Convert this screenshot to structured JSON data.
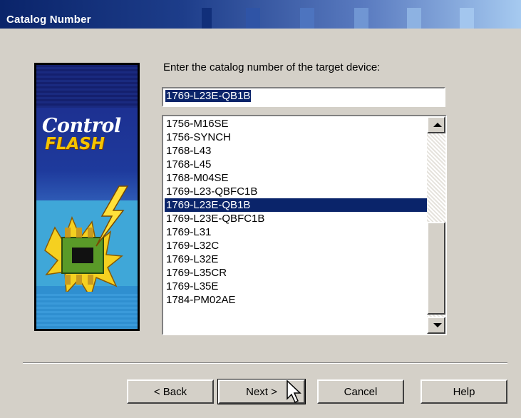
{
  "window": {
    "title": "Catalog Number"
  },
  "logo": {
    "line1": "Control",
    "line2": "FLASH"
  },
  "prompt": {
    "text": "Enter the catalog number of the target device:"
  },
  "catalog_input": {
    "value": "1769-L23E-QB1B"
  },
  "catalog_list": {
    "items": [
      "1756-M16SE",
      "1756-SYNCH",
      "1768-L43",
      "1768-L45",
      "1768-M04SE",
      "1769-L23-QBFC1B",
      "1769-L23E-QB1B",
      "1769-L23E-QBFC1B",
      "1769-L31",
      "1769-L32C",
      "1769-L32E",
      "1769-L35CR",
      "1769-L35E",
      "1784-PM02AE"
    ],
    "selected": "1769-L23E-QB1B"
  },
  "buttons": {
    "back": "< Back",
    "next": "Next >",
    "cancel": "Cancel",
    "help": "Help"
  },
  "colors": {
    "title_bar": "#0a246a",
    "selection": "#0a246a",
    "dialog_bg": "#d4d0c8",
    "logo_yellow": "#f5c400"
  }
}
